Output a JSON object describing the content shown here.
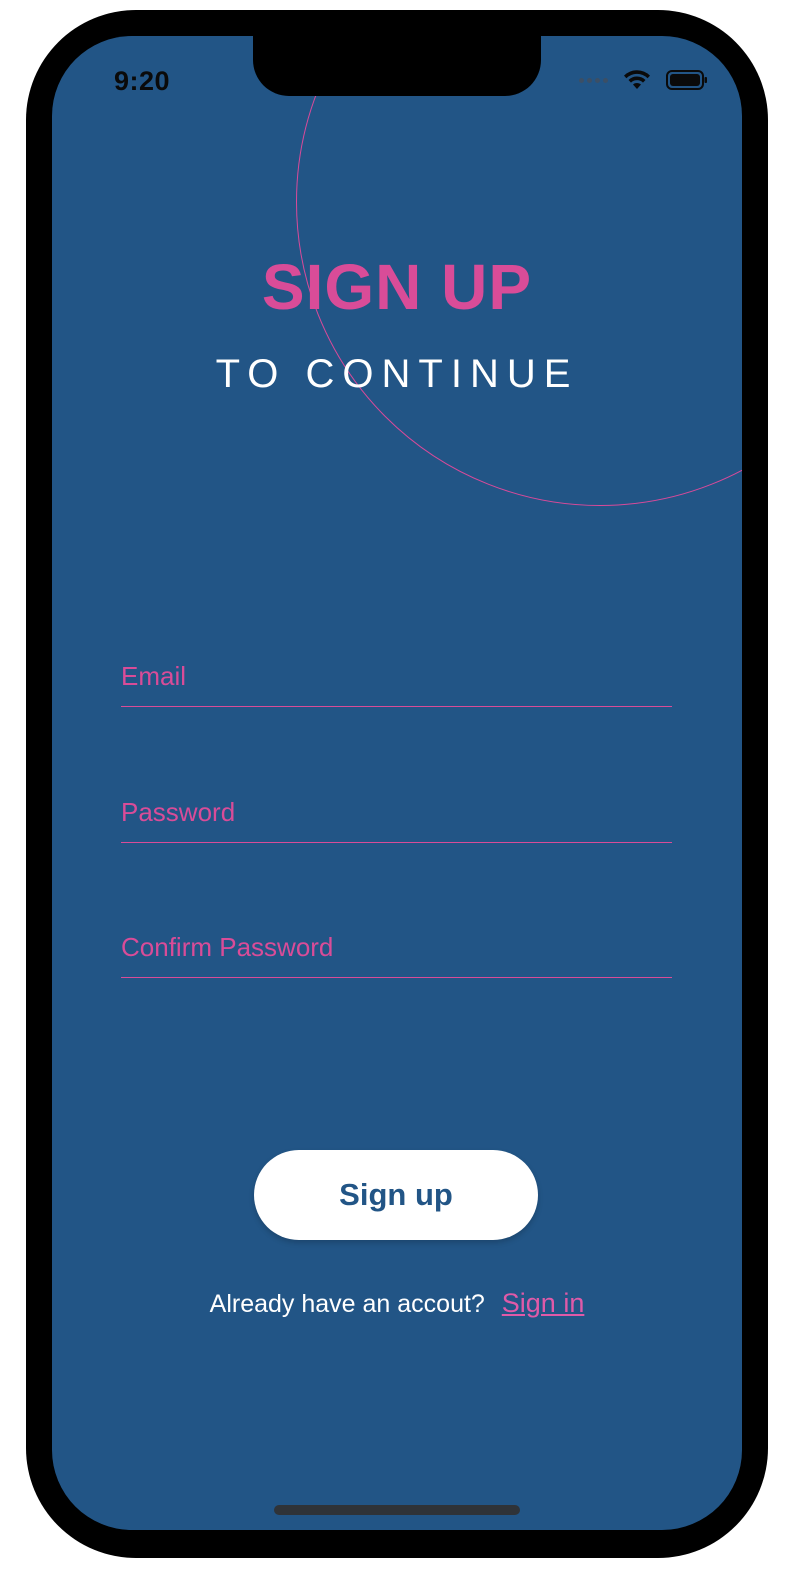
{
  "status_bar": {
    "time": "9:20"
  },
  "header": {
    "title": "SIGN UP",
    "subtitle": "TO CONTINUE"
  },
  "form": {
    "email": {
      "placeholder": "Email",
      "value": ""
    },
    "password": {
      "placeholder": "Password",
      "value": ""
    },
    "confirm_password": {
      "placeholder": "Confirm Password",
      "value": ""
    }
  },
  "actions": {
    "signup_label": "Sign up",
    "signin_prompt": "Already have an accout?",
    "signin_label": "Sign in"
  },
  "colors": {
    "background": "#225586",
    "accent": "#d94c98",
    "button_bg": "#ffffff",
    "button_text": "#225586"
  }
}
